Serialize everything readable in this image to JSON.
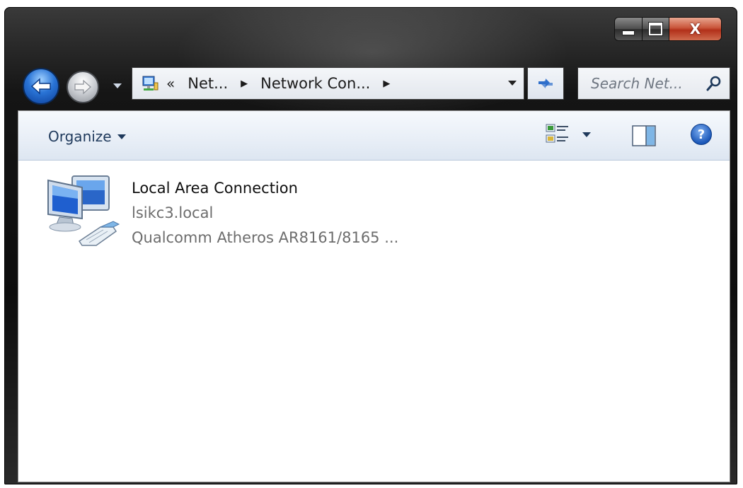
{
  "window": {
    "buttons": {
      "minimize": "minimize",
      "maximize": "maximize",
      "close": "X"
    }
  },
  "navigation": {
    "back_icon": "back-arrow-icon",
    "forward_icon": "forward-arrow-icon"
  },
  "address_bar": {
    "overflow": "«",
    "crumbs": [
      "Net...",
      "Network Con..."
    ]
  },
  "search": {
    "placeholder": "Search Net..."
  },
  "toolbar": {
    "organize_label": "Organize"
  },
  "help_glyph": "?",
  "items": [
    {
      "name": "Local Area Connection",
      "network": "lsikc3.local",
      "adapter": "Qualcomm Atheros AR8161/8165 ..."
    }
  ],
  "colors": {
    "toolbar_text": "#1e395b",
    "secondary_text": "#6d6d6d",
    "close_button": "#c9553a"
  }
}
